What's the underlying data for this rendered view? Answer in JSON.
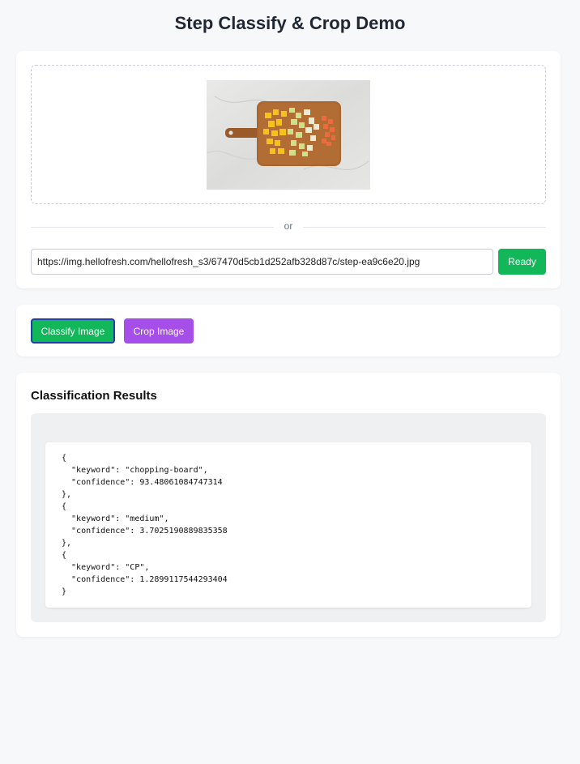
{
  "page": {
    "title": "Step Classify & Crop Demo"
  },
  "upload": {
    "divider_text": "or",
    "url_value": "https://img.hellofresh.com/hellofresh_s3/67470d5cb1d252afb328d87c/step-ea9c6e20.jpg",
    "status_label": "Ready"
  },
  "actions": {
    "classify_label": "Classify Image",
    "crop_label": "Crop Image"
  },
  "results": {
    "heading": "Classification Results",
    "items": [
      {
        "keyword": "chopping-board",
        "confidence": "93.48061084747314"
      },
      {
        "keyword": "medium",
        "confidence": "3.7025190889835358"
      },
      {
        "keyword": "CP",
        "confidence": "1.2899117544293404"
      }
    ]
  },
  "colors": {
    "accent_green": "#12b75a",
    "accent_purple": "#a64ee8",
    "focus_ring": "#1f3fae"
  }
}
